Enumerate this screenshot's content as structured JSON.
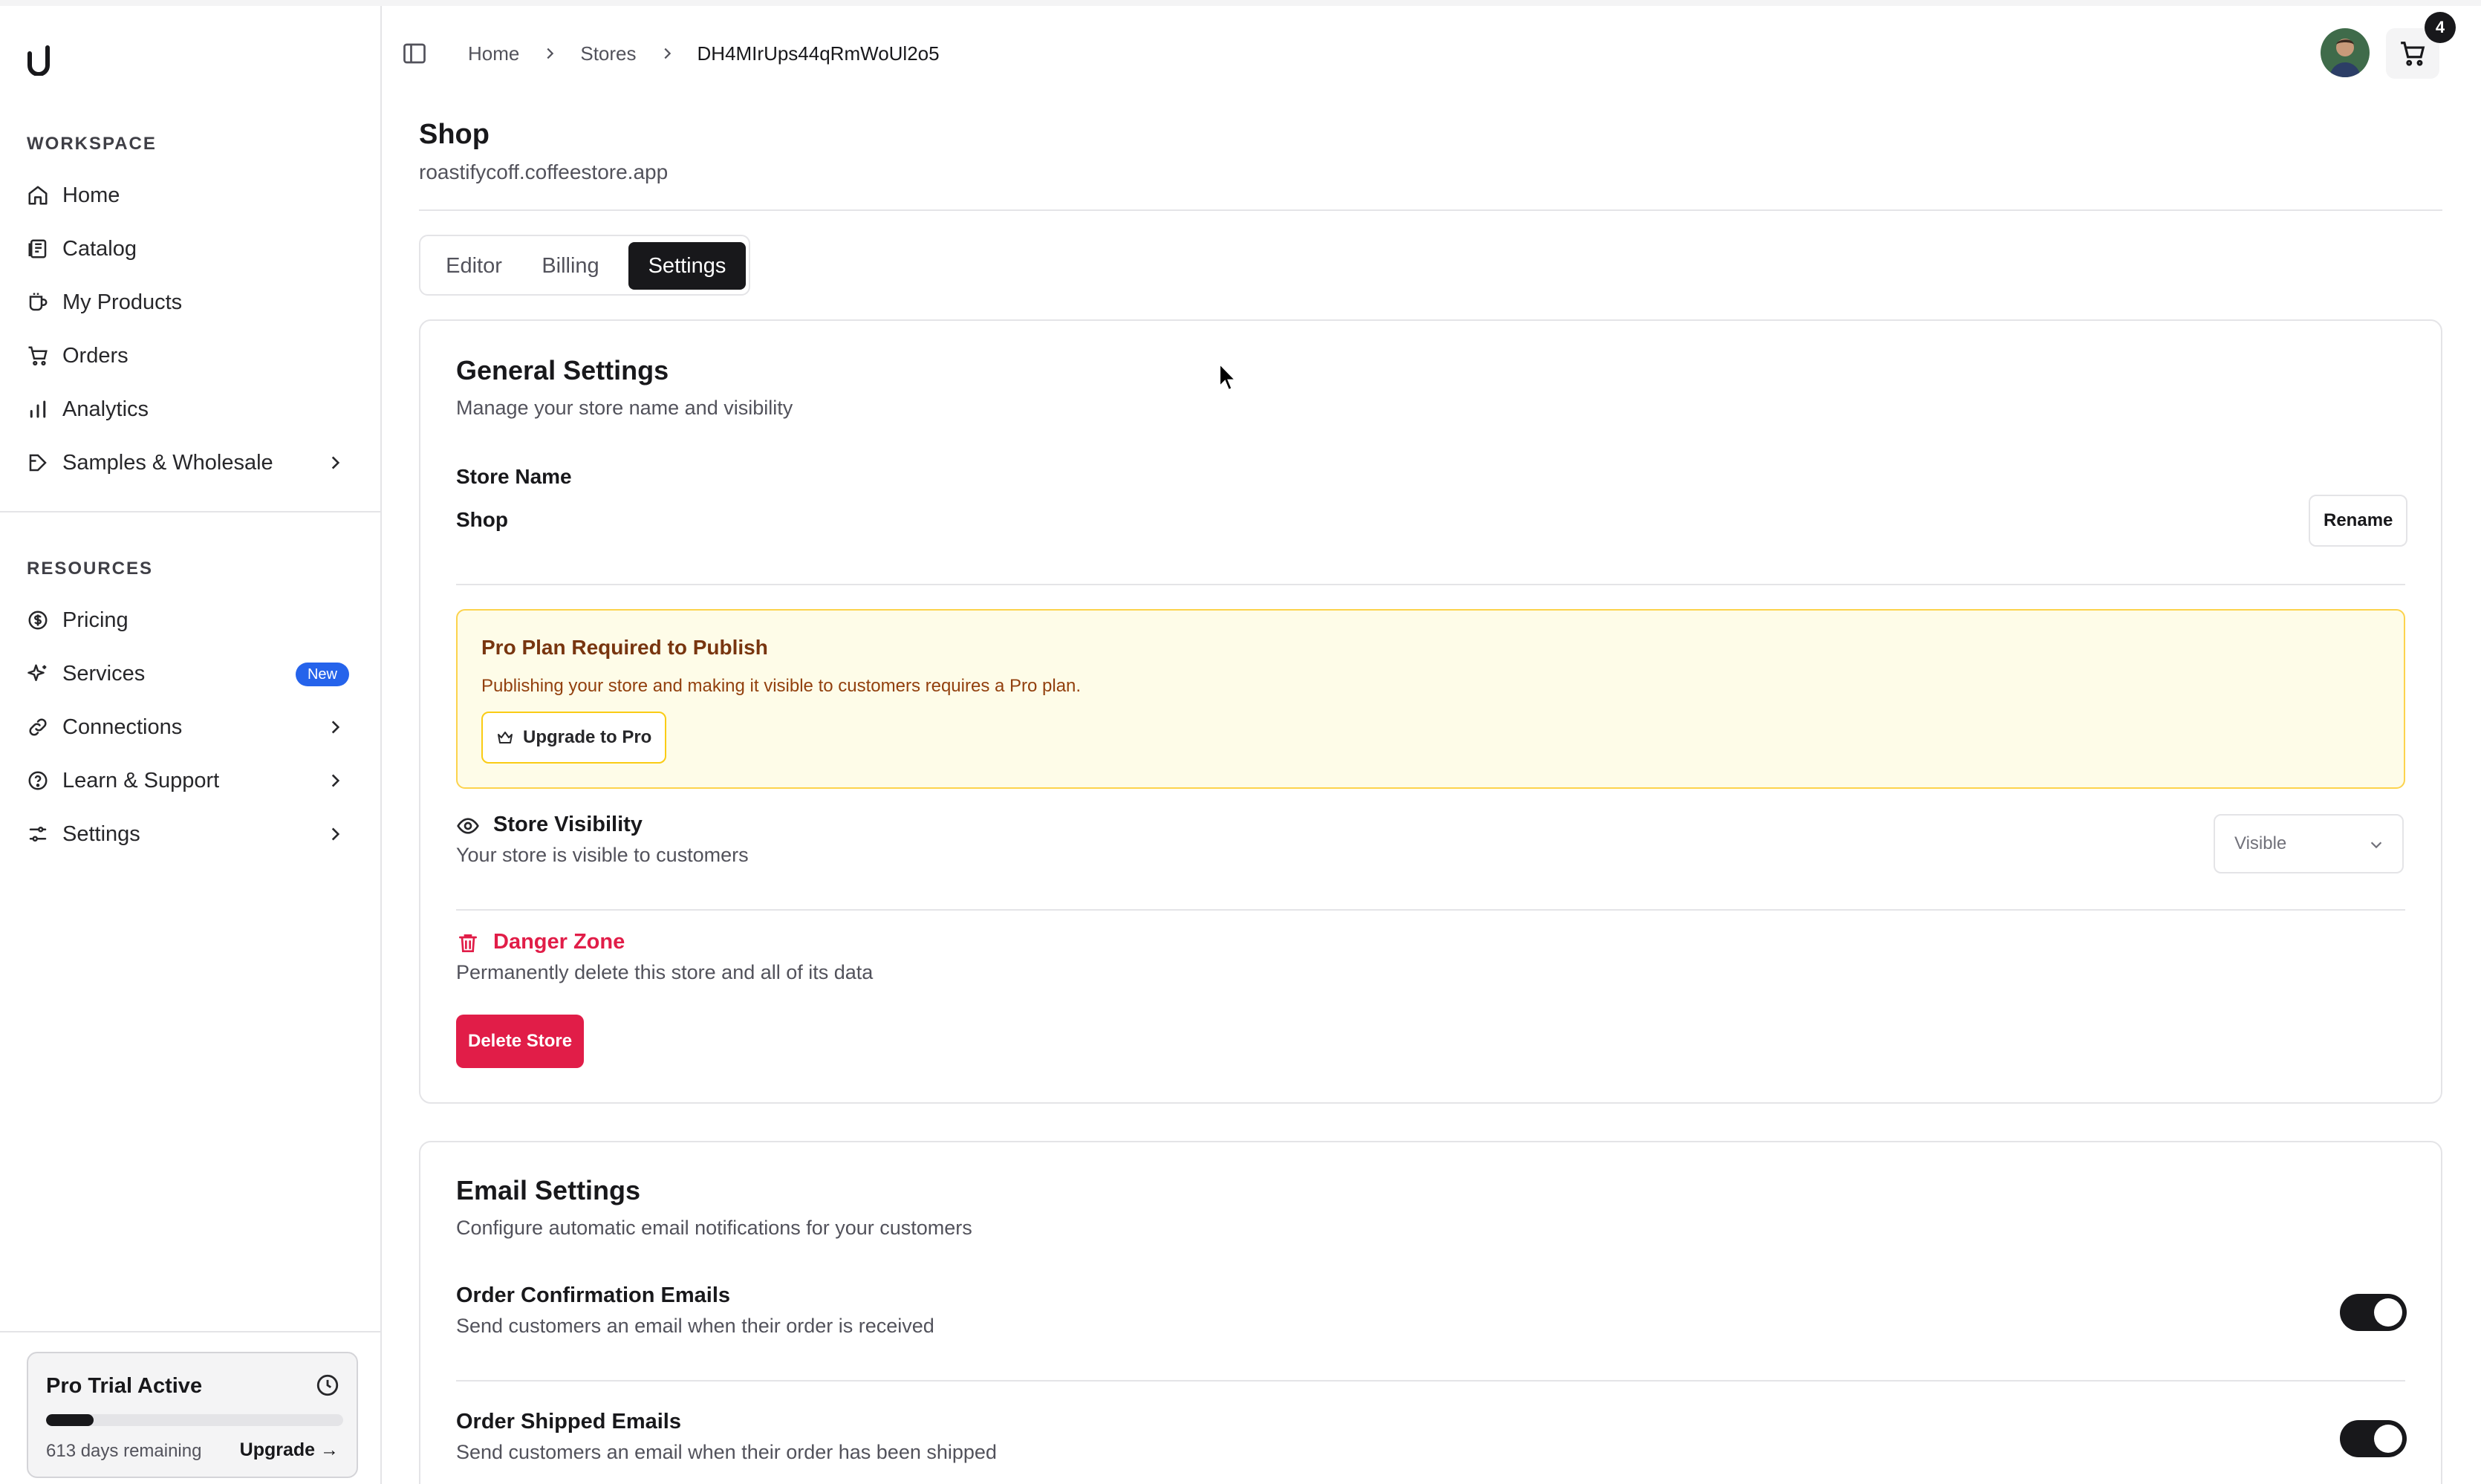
{
  "sidebar": {
    "workspace_label": "WORKSPACE",
    "resources_label": "RESOURCES",
    "workspace_items": [
      {
        "label": "Home",
        "icon": "home-icon"
      },
      {
        "label": "Catalog",
        "icon": "catalog-icon"
      },
      {
        "label": "My Products",
        "icon": "mug-icon"
      },
      {
        "label": "Orders",
        "icon": "cart-icon"
      },
      {
        "label": "Analytics",
        "icon": "bar-chart-icon"
      },
      {
        "label": "Samples & Wholesale",
        "icon": "package-icon",
        "expandable": true
      }
    ],
    "resource_items": [
      {
        "label": "Pricing",
        "icon": "dollar-icon"
      },
      {
        "label": "Services",
        "icon": "sparkle-icon",
        "badge": "New"
      },
      {
        "label": "Connections",
        "icon": "link-icon",
        "expandable": true
      },
      {
        "label": "Learn & Support",
        "icon": "help-icon",
        "expandable": true
      },
      {
        "label": "Settings",
        "icon": "sliders-icon",
        "expandable": true
      }
    ],
    "trial": {
      "title": "Pro Trial Active",
      "days_remaining": "613 days remaining",
      "upgrade_label": "Upgrade →",
      "progress": 0.16
    }
  },
  "header": {
    "breadcrumb": [
      "Home",
      "Stores",
      "DH4MIrUps44qRmWoUl2o5"
    ],
    "cart_count": "4"
  },
  "page": {
    "title": "Shop",
    "subtitle": "roastifycoff.coffeestore.app",
    "tabs": [
      {
        "label": "Editor",
        "active": false
      },
      {
        "label": "Billing",
        "active": false
      },
      {
        "label": "Settings",
        "active": true
      }
    ]
  },
  "general": {
    "title": "General Settings",
    "subtitle": "Manage your store name and visibility",
    "store_name_label": "Store Name",
    "store_name_value": "Shop",
    "rename_label": "Rename",
    "alert": {
      "title": "Pro Plan Required to Publish",
      "text": "Publishing your store and making it visible to customers requires a Pro plan.",
      "button": "Upgrade to Pro"
    },
    "visibility": {
      "title": "Store Visibility",
      "subtitle": "Your store is visible to customers",
      "selected": "Visible"
    },
    "danger": {
      "title": "Danger Zone",
      "subtitle": "Permanently delete this store and all of its data",
      "button": "Delete Store"
    }
  },
  "email": {
    "title": "Email Settings",
    "subtitle": "Configure automatic email notifications for your customers",
    "rows": [
      {
        "title": "Order Confirmation Emails",
        "subtitle": "Send customers an email when their order is received",
        "enabled": true
      },
      {
        "title": "Order Shipped Emails",
        "subtitle": "Send customers an email when their order has been shipped",
        "enabled": true
      }
    ]
  },
  "colors": {
    "accent": "#18181b",
    "danger": "#e11d48",
    "badge": "#2563eb",
    "alert_bg": "#fefce8",
    "alert_border": "#fcd34d"
  }
}
